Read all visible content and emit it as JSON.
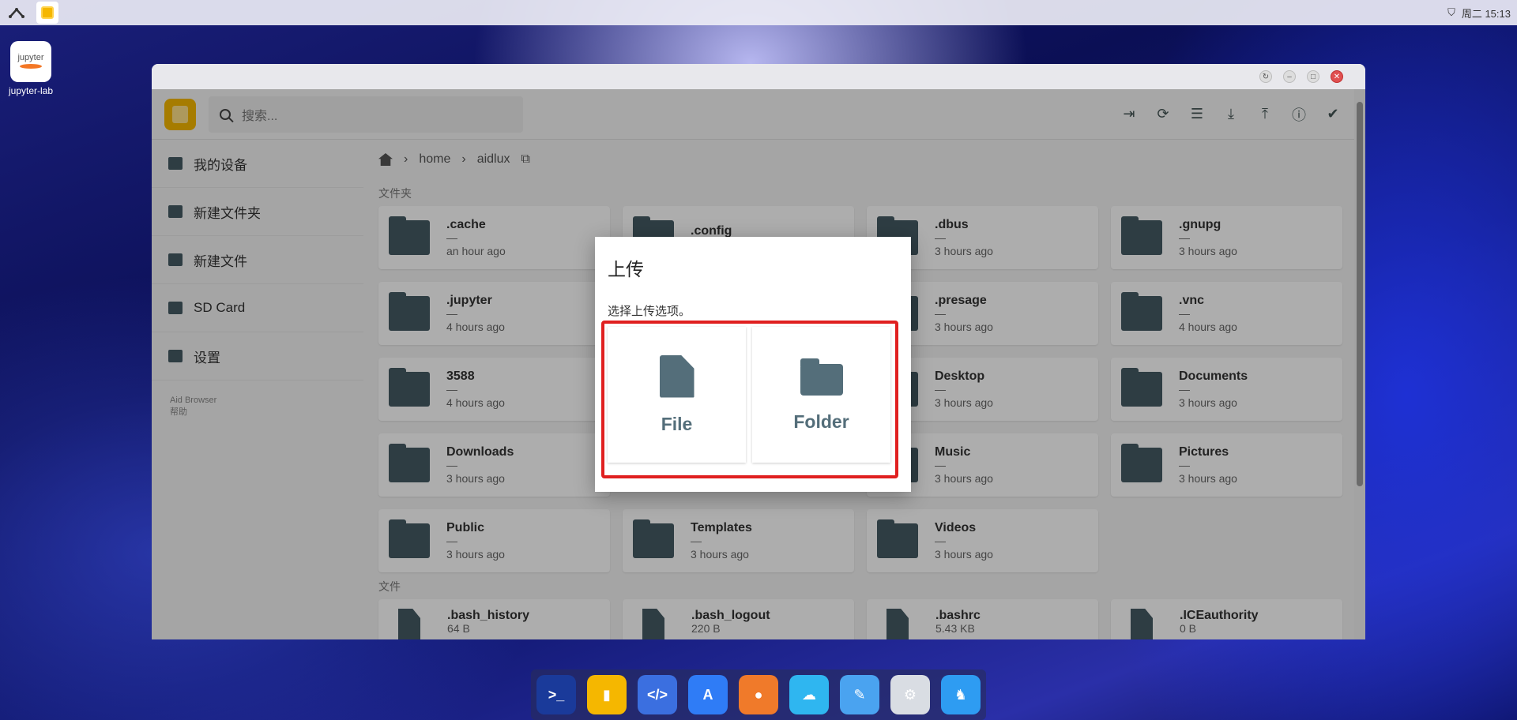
{
  "topbar": {
    "clock": "周二 15:13",
    "network": "⛉"
  },
  "desktop": {
    "icon_label": "jupyter-lab",
    "icon_text": "jupyter"
  },
  "window": {
    "buttons": [
      "↻",
      "–",
      "□",
      "✕"
    ]
  },
  "app": {
    "search_placeholder": "搜索...",
    "toolbar_icons": [
      "exit-icon",
      "refresh-icon",
      "list-view-icon",
      "download-icon",
      "upload-icon",
      "info-icon",
      "select-all-icon"
    ],
    "sidebar": {
      "items": [
        {
          "label": "我的设备",
          "icon": "folder-icon"
        },
        {
          "label": "新建文件夹",
          "icon": "new-folder-icon"
        },
        {
          "label": "新建文件",
          "icon": "new-file-icon"
        },
        {
          "label": "SD Card",
          "icon": "sd-card-icon"
        },
        {
          "label": "设置",
          "icon": "settings-icon"
        }
      ],
      "footer_title": "Aid Browser",
      "footer_help": "帮助"
    },
    "breadcrumb": [
      "home",
      "aidlux"
    ],
    "folders_label": "文件夹",
    "files_label": "文件",
    "folders": [
      {
        "name": ".cache",
        "size": "—",
        "time": "an hour ago"
      },
      {
        "name": ".config",
        "size": "—",
        "time": ""
      },
      {
        "name": ".dbus",
        "size": "—",
        "time": "3 hours ago"
      },
      {
        "name": ".gnupg",
        "size": "—",
        "time": "3 hours ago"
      },
      {
        "name": ".jupyter",
        "size": "—",
        "time": "4 hours ago"
      },
      {
        "name": "",
        "size": "",
        "time": ""
      },
      {
        "name": ".presage",
        "size": "—",
        "time": "3 hours ago"
      },
      {
        "name": ".vnc",
        "size": "—",
        "time": "4 hours ago"
      },
      {
        "name": "3588",
        "size": "—",
        "time": "4 hours ago"
      },
      {
        "name": "",
        "size": "",
        "time": ""
      },
      {
        "name": "Desktop",
        "size": "—",
        "time": "3 hours ago"
      },
      {
        "name": "Documents",
        "size": "—",
        "time": "3 hours ago"
      },
      {
        "name": "Downloads",
        "size": "—",
        "time": "3 hours ago"
      },
      {
        "name": "",
        "size": "",
        "time": ""
      },
      {
        "name": "Music",
        "size": "—",
        "time": "3 hours ago"
      },
      {
        "name": "Pictures",
        "size": "—",
        "time": "3 hours ago"
      },
      {
        "name": "Public",
        "size": "—",
        "time": "3 hours ago"
      },
      {
        "name": "Templates",
        "size": "—",
        "time": "3 hours ago"
      },
      {
        "name": "Videos",
        "size": "—",
        "time": "3 hours ago"
      }
    ],
    "files": [
      {
        "name": ".bash_history",
        "size": "64 B"
      },
      {
        "name": ".bash_logout",
        "size": "220 B"
      },
      {
        "name": ".bashrc",
        "size": "5.43 KB"
      },
      {
        "name": ".ICEauthority",
        "size": "0 B"
      }
    ]
  },
  "dialog": {
    "title": "上传",
    "subtitle": "选择上传选项。",
    "file_label": "File",
    "folder_label": "Folder"
  },
  "dock": {
    "apps": [
      {
        "name": "terminal-icon",
        "color": "#1a3a9a",
        "glyph": ">_"
      },
      {
        "name": "files-icon",
        "color": "#f5b700",
        "glyph": "▮"
      },
      {
        "name": "code-icon",
        "color": "#3b6fe0",
        "glyph": "</>"
      },
      {
        "name": "appstore-icon",
        "color": "#2f7cf6",
        "glyph": "A"
      },
      {
        "name": "bulb-icon",
        "color": "#f07a2a",
        "glyph": "●"
      },
      {
        "name": "cloud-icon",
        "color": "#2fb6f0",
        "glyph": "☁"
      },
      {
        "name": "tools-icon",
        "color": "#4aa3f0",
        "glyph": "✎"
      },
      {
        "name": "settings-icon",
        "color": "#d9dde3",
        "glyph": "⚙"
      },
      {
        "name": "mascot-icon",
        "color": "#2e9cf2",
        "glyph": "♞"
      }
    ]
  }
}
